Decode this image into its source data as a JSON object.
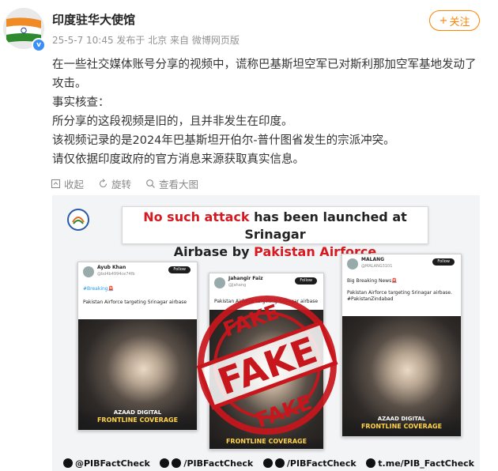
{
  "account": {
    "name": "印度驻华大使馆",
    "meta": "25-5-7 10:45  发布于 北京  来自 微博网页版",
    "follow_label": "关注",
    "follow_plus": "+"
  },
  "post": {
    "lines": [
      "在一些社交媒体账号分享的视频中，谎称巴基斯坦空军已对斯利那加空军基地发动了攻击。",
      "事实核查：",
      "所分享的这段视频是旧的，且并非发生在印度。",
      "该视频记录的是2024年巴基斯坦开伯尔-普什图省发生的宗派冲突。",
      "请仅依据印度政府的官方消息来源获取真实信息。"
    ]
  },
  "actions": {
    "collect": "收起",
    "rotate": "旋转",
    "view_large": "查看大图"
  },
  "media": {
    "banner_line1_red": "No such attack",
    "banner_line1_rest": " has been launched at Srinagar",
    "banner_line2_start": "Airbase by ",
    "banner_line2_red": "Pakistan Airforce",
    "stamp_text_big": "FAKE",
    "stamp_text_small": "FAKE",
    "cards": [
      {
        "user": "Ayub Khan",
        "handle": "@bd4b4994ce74fb",
        "follow": "Follow",
        "tag": "#Breaking🚨",
        "text": "Pakistan Airforce targeting Srinagar airbase",
        "footer1": "AZAAD DIGITAL",
        "footer2": "FRONTLINE COVERAGE"
      },
      {
        "user": "Jahangir Faiz",
        "handle": "@Jahang",
        "follow": "Follow",
        "tag": "",
        "text": "Pakistan Airforce targeting Srinagar airbase",
        "footer1": "",
        "footer2": "FRONTLINE COVERAGE"
      },
      {
        "user": "MALANG",
        "handle": "@MALANG3101",
        "follow": "Follow",
        "tag": "Big Breaking News🚨",
        "text": "Pakistan Airforce targeting Srinagar airbase. #PakistanZindabad",
        "footer1": "AZAAD DIGITAL",
        "footer2": "FRONTLINE COVERAGE"
      }
    ],
    "social": [
      "@PIBFactCheck",
      "/PIBFactCheck",
      "/PIBFactCheck",
      "t.me/PIB_FactCheck"
    ]
  },
  "colors": {
    "accent_orange": "#ff8200",
    "stamp_red": "#c8161d",
    "verify_blue": "#3a8ef6"
  }
}
